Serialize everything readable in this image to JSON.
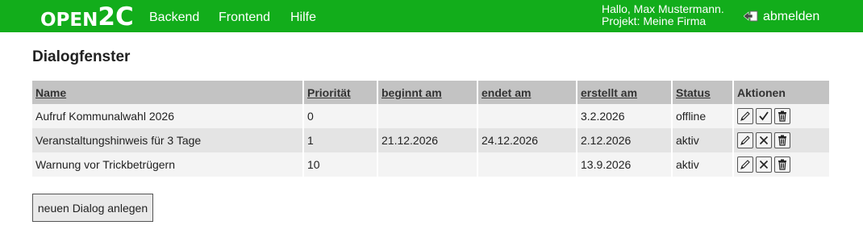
{
  "brand": {
    "logo_part1": "OPEN",
    "logo_part2": "2C"
  },
  "nav": [
    {
      "label": "Backend"
    },
    {
      "label": "Frontend"
    },
    {
      "label": "Hilfe"
    }
  ],
  "user": {
    "greeting": "Hallo, Max Mustermann.",
    "project": "Projekt: Meine Firma"
  },
  "logout": {
    "label": "abmelden",
    "icon": "logout-icon"
  },
  "page": {
    "title": "Dialogfenster"
  },
  "table": {
    "columns": [
      {
        "label": "Name",
        "sortable": true
      },
      {
        "label": "Priorität",
        "sortable": true
      },
      {
        "label": "beginnt am",
        "sortable": true
      },
      {
        "label": "endet am",
        "sortable": true
      },
      {
        "label": "erstellt am",
        "sortable": true
      },
      {
        "label": "Status",
        "sortable": true
      },
      {
        "label": "Aktionen",
        "sortable": false
      }
    ],
    "rows": [
      {
        "name": "Aufruf Kommunalwahl 2026",
        "priority": "0",
        "start": "",
        "end": "",
        "created": "3.2.2026",
        "status": "offline",
        "toggle": "check-icon"
      },
      {
        "name": "Veranstaltungshinweis für 3 Tage",
        "priority": "1",
        "start": "21.12.2026",
        "end": "24.12.2026",
        "created": "2.12.2026",
        "status": "aktiv",
        "toggle": "x-icon"
      },
      {
        "name": "Warnung vor Trickbetrügern",
        "priority": "10",
        "start": "",
        "end": "",
        "created": "13.9.2026",
        "status": "aktiv",
        "toggle": "x-icon"
      }
    ]
  },
  "new_dialog_button": {
    "label": "neuen Dialog anlegen"
  }
}
